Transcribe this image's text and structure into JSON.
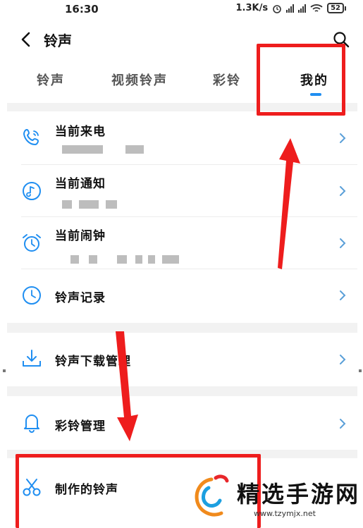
{
  "status_bar": {
    "time": "16:30",
    "speed": "1.3K/s",
    "battery": "52"
  },
  "header": {
    "title": "铃声"
  },
  "tabs": [
    {
      "label": "铃声"
    },
    {
      "label": "视频铃声"
    },
    {
      "label": "彩铃"
    },
    {
      "label": "我的"
    }
  ],
  "list": {
    "current_call": "当前来电",
    "current_notification": "当前通知",
    "current_alarm": "当前闹钟",
    "ringtone_history": "铃声记录",
    "download_manager": "铃声下载管理",
    "crbt_manager": "彩铃管理",
    "made_ringtones": "制作的铃声"
  },
  "watermark": {
    "name": "精选手游网",
    "url": "www.tzymjx.net"
  },
  "colors": {
    "accent": "#1f8ef1",
    "highlight": "#ee1d1d"
  }
}
